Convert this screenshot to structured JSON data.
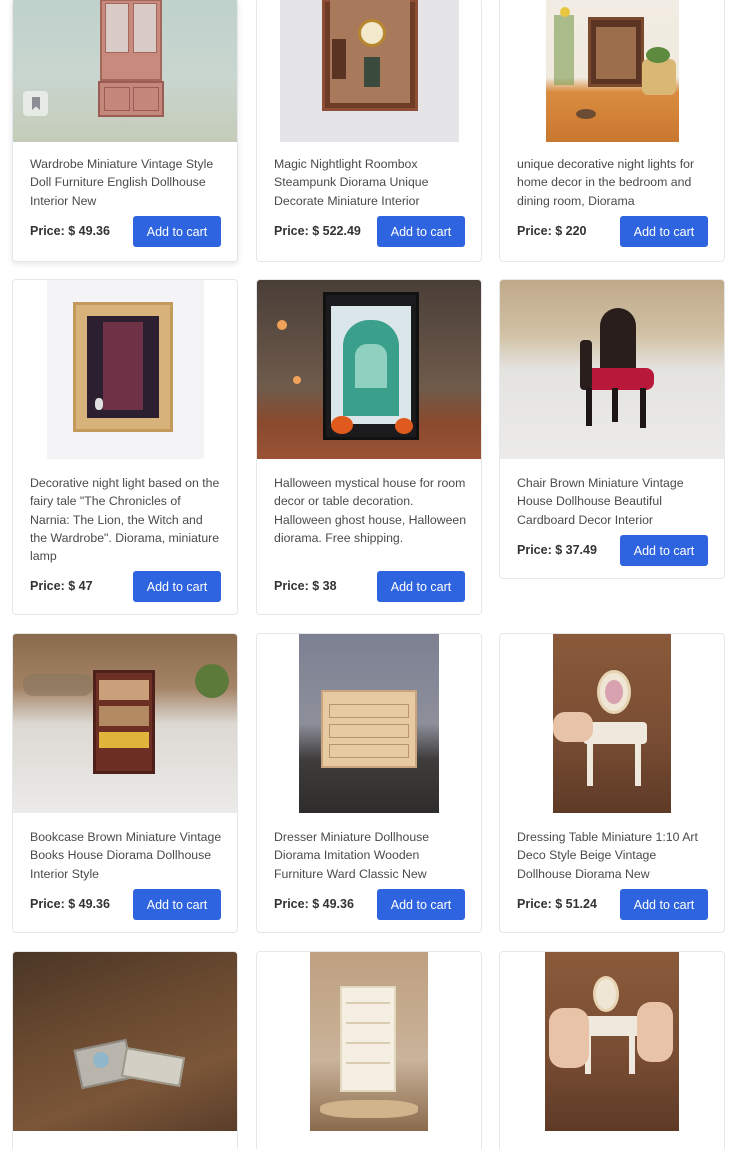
{
  "bookmark_icon": "bookmark-icon",
  "accent_color": "#2f64e0",
  "products": [
    {
      "title": "Wardrobe Miniature Vintage Style Doll Furniture English Dollhouse Interior New",
      "price": "Price: $ 49.36",
      "cta": "Add to cart"
    },
    {
      "title": "Magic Nightlight Roombox Steampunk Diorama Unique Decorate Miniature Interior",
      "price": "Price: $ 522.49",
      "cta": "Add to cart"
    },
    {
      "title": "unique decorative night lights for home decor in the bedroom and dining room, Diorama",
      "price": "Price: $ 220",
      "cta": "Add to cart"
    },
    {
      "title": "Decorative night light based on the fairy tale \"The Chronicles of Narnia: The Lion, the Witch and the Wardrobe\". Diorama, miniature lamp",
      "price": "Price: $ 47",
      "cta": "Add to cart"
    },
    {
      "title": "Halloween mystical house for room decor or table decoration. Halloween ghost house, Halloween diorama. Free shipping.",
      "price": "Price: $ 38",
      "cta": "Add to cart"
    },
    {
      "title": "Chair Brown Miniature Vintage House Dollhouse Beautiful Cardboard Decor Interior",
      "price": "Price: $ 37.49",
      "cta": "Add to cart"
    },
    {
      "title": "Bookcase Brown Miniature Vintage Books House Diorama Dollhouse Interior Style",
      "price": "Price: $ 49.36",
      "cta": "Add to cart"
    },
    {
      "title": "Dresser Miniature Dollhouse Diorama Imitation Wooden Furniture Ward Classic New",
      "price": "Price: $ 49.36",
      "cta": "Add to cart"
    },
    {
      "title": "Dressing Table Miniature 1:10 Art Deco Style Beige Vintage Dollhouse Diorama New",
      "price": "Price: $ 51.24",
      "cta": "Add to cart"
    },
    {
      "title": "",
      "price": "",
      "cta": ""
    },
    {
      "title": "",
      "price": "",
      "cta": ""
    },
    {
      "title": "",
      "price": "",
      "cta": ""
    }
  ]
}
